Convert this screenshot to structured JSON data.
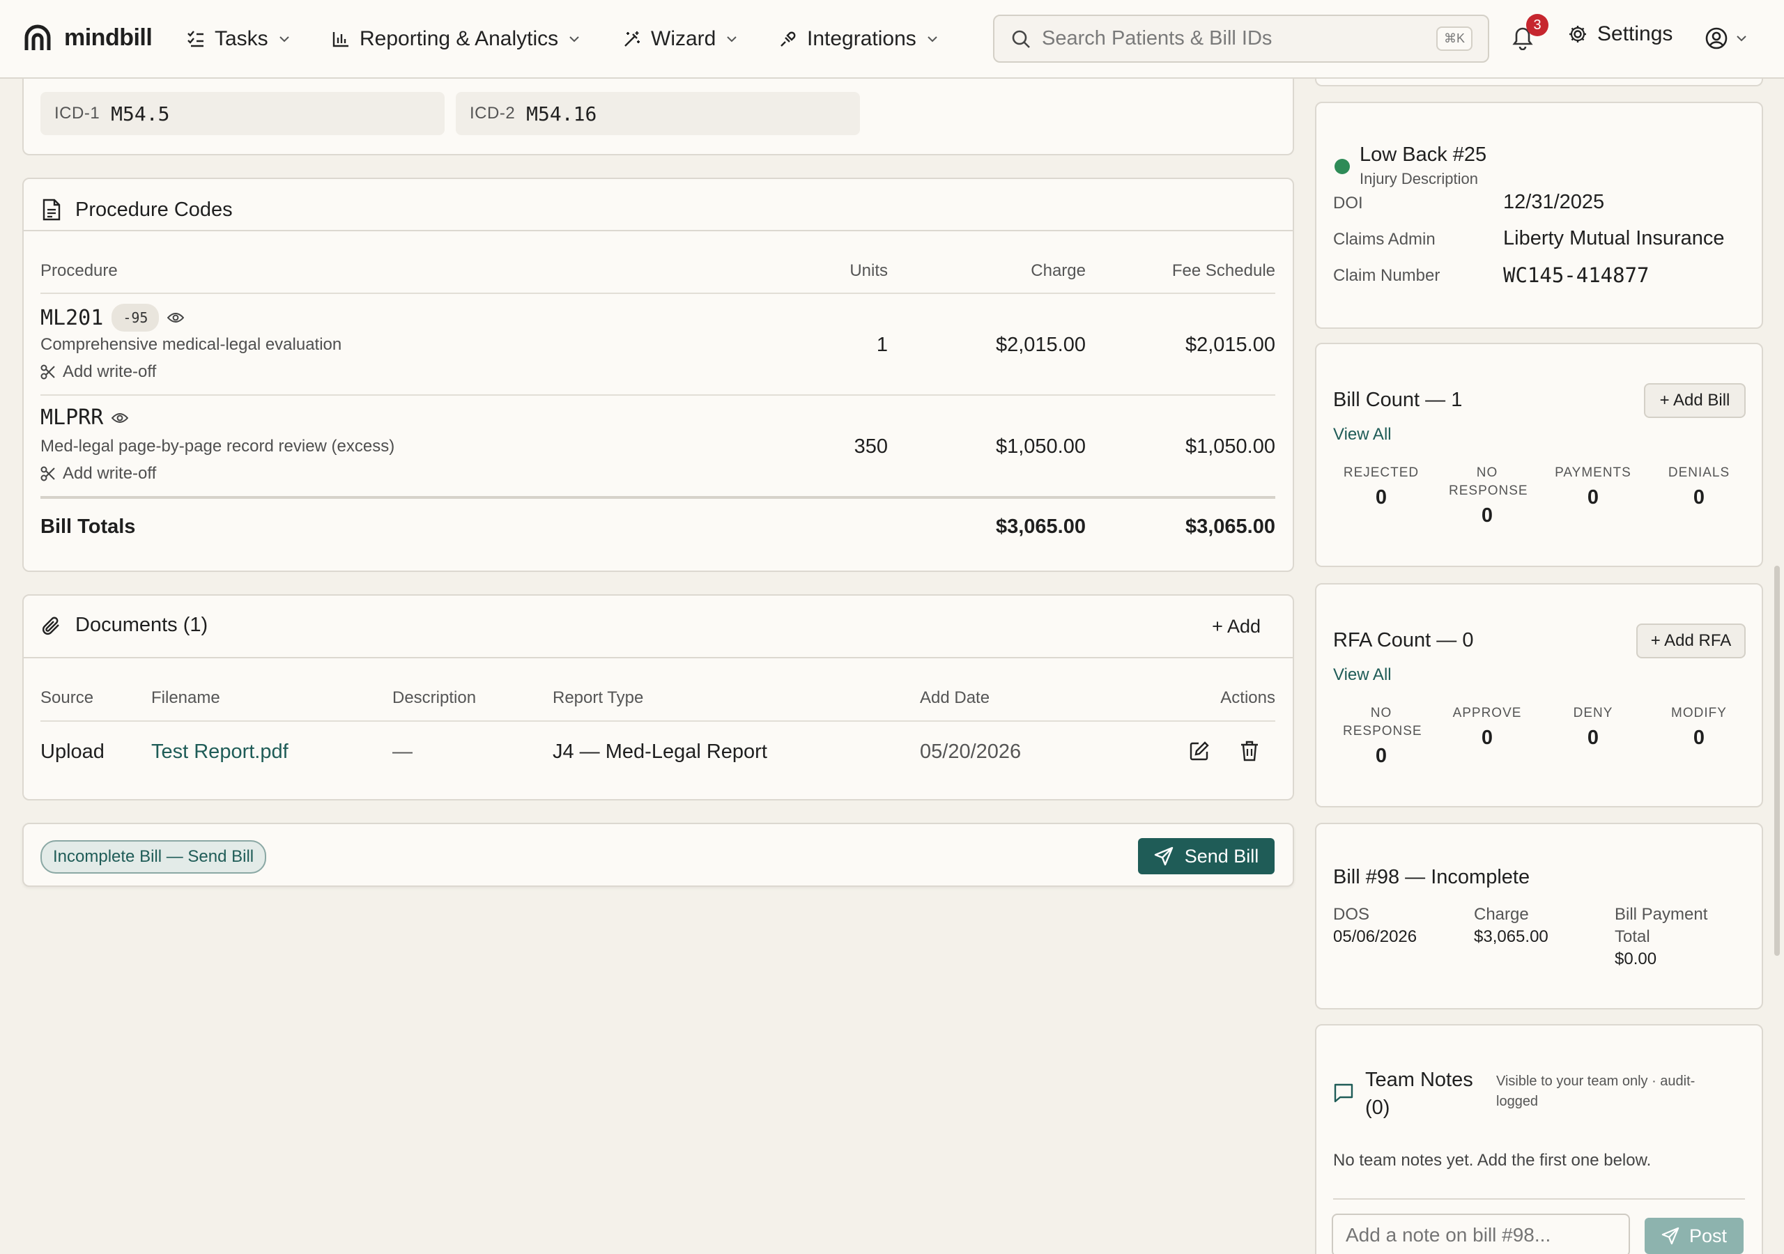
{
  "nav": {
    "brand": "mindbill",
    "menus": [
      {
        "label": "Tasks",
        "icon": "tasks-icon"
      },
      {
        "label": "Reporting & Analytics",
        "icon": "chart-icon"
      },
      {
        "label": "Wizard",
        "icon": "wand-icon"
      },
      {
        "label": "Integrations",
        "icon": "plug-icon"
      }
    ],
    "search_placeholder": "Search Patients & Bill IDs",
    "search_shortcut": "⌘K",
    "notifications_count": "3",
    "settings_label": "Settings"
  },
  "icd": [
    {
      "label": "ICD-1",
      "code": "M54.5"
    },
    {
      "label": "ICD-2",
      "code": "M54.16"
    }
  ],
  "procedures": {
    "title": "Procedure Codes",
    "headers": {
      "procedure": "Procedure",
      "units": "Units",
      "charge": "Charge",
      "fee": "Fee Schedule"
    },
    "rows": [
      {
        "code": "ML201",
        "modifier": "-95",
        "description": "Comprehensive medical-legal evaluation",
        "writeoff": "Add write-off",
        "units": "1",
        "charge": "$2,015.00",
        "fee": "$2,015.00"
      },
      {
        "code": "MLPRR",
        "modifier": "",
        "description": "Med-legal page-by-page record review (excess)",
        "writeoff": "Add write-off",
        "units": "350",
        "charge": "$1,050.00",
        "fee": "$1,050.00"
      }
    ],
    "totals": {
      "label": "Bill Totals",
      "charge": "$3,065.00",
      "fee": "$3,065.00"
    }
  },
  "documents": {
    "title": "Documents (1)",
    "add_label": "+ Add",
    "headers": {
      "source": "Source",
      "filename": "Filename",
      "description": "Description",
      "report_type": "Report Type",
      "add_date": "Add Date",
      "actions": "Actions"
    },
    "rows": [
      {
        "source": "Upload",
        "filename": "Test Report.pdf",
        "description": "—",
        "report_type": "J4 — Med-Legal Report",
        "add_date": "05/20/2026"
      }
    ]
  },
  "bill_status": {
    "pill": "Incomplete Bill — Send Bill",
    "send_label": "Send Bill"
  },
  "injury": {
    "title": "Low Back #25",
    "subtitle": "Injury Description",
    "status_color": "#2e8b57",
    "doi_label": "DOI",
    "doi": "12/31/2025",
    "admin_label": "Claims Admin",
    "admin": "Liberty Mutual Insurance",
    "claim_label": "Claim Number",
    "claim": "WC145-414877"
  },
  "bill_count": {
    "title": "Bill Count — 1",
    "add_label": "+ Add Bill",
    "view_all": "View All",
    "stats": [
      {
        "label": "REJECTED",
        "value": "0"
      },
      {
        "label": "NO RESPONSE",
        "value": "0"
      },
      {
        "label": "PAYMENTS",
        "value": "0"
      },
      {
        "label": "DENIALS",
        "value": "0"
      }
    ]
  },
  "rfa_count": {
    "title": "RFA Count — 0",
    "add_label": "+ Add RFA",
    "view_all": "View All",
    "stats": [
      {
        "label": "NO RESPONSE",
        "value": "0"
      },
      {
        "label": "APPROVE",
        "value": "0"
      },
      {
        "label": "DENY",
        "value": "0"
      },
      {
        "label": "MODIFY",
        "value": "0"
      }
    ]
  },
  "bill98": {
    "title": "Bill #98 — Incomplete",
    "dos_label": "DOS",
    "dos": "05/06/2026",
    "charge_label": "Charge",
    "charge": "$3,065.00",
    "payment_label": "Bill Payment Total",
    "payment": "$0.00"
  },
  "team_notes": {
    "title": "Team Notes (0)",
    "hint": "Visible to your team only · audit-logged",
    "empty": "No team notes yet. Add the first one below.",
    "placeholder": "Add a note on bill #98...",
    "post_label": "Post"
  },
  "colors": {
    "accent": "#1f5c57",
    "background": "#f4f1ea",
    "card": "#fcfaf6",
    "badge": "#c6262e"
  }
}
